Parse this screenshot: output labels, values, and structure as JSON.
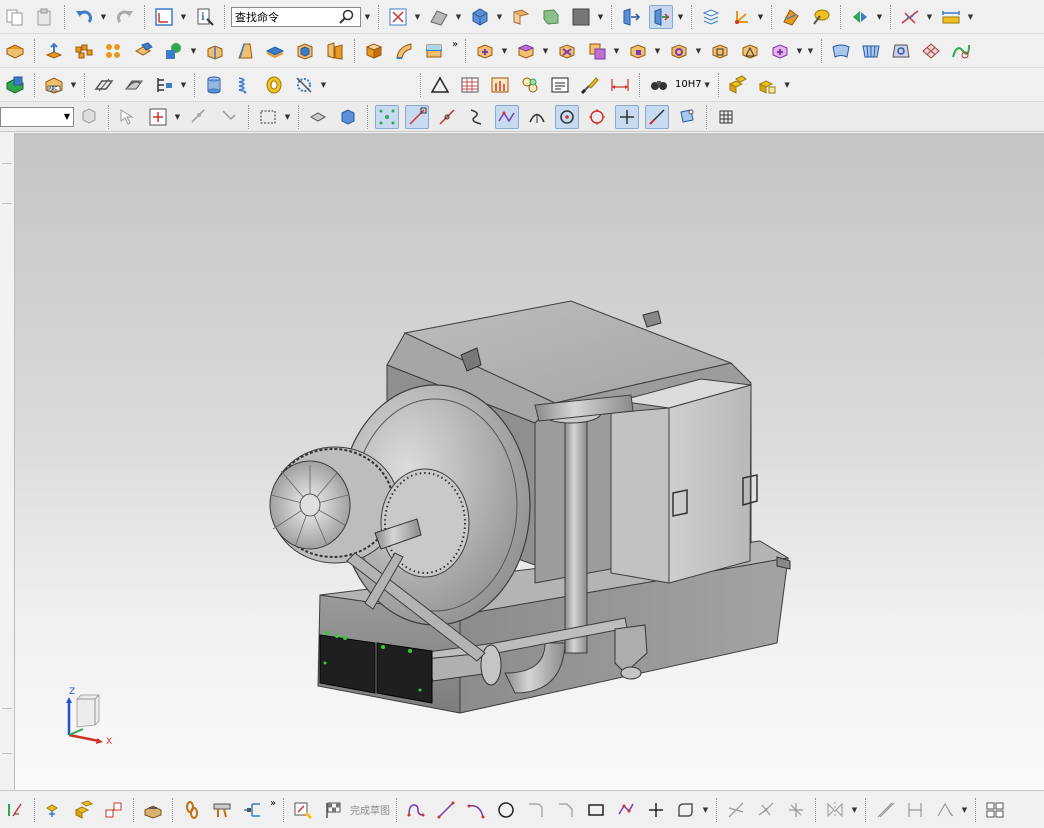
{
  "toolbar": {
    "search_placeholder": "查找命令",
    "search_value": "查找命令",
    "filter_value": "",
    "tolerance_label": "10H7"
  },
  "bottom_toolbar": {
    "finish_sketch_label": "完成草图"
  },
  "viewport": {
    "background_top": "#c4c4c4",
    "background_bottom": "#fafafa"
  },
  "triad": {
    "z_label": "Z",
    "x_label": "X"
  },
  "colors": {
    "accent_orange": "#e89a1e",
    "accent_blue": "#3c7cc8",
    "accent_yellow": "#f0c020",
    "accent_red": "#d0332a",
    "model_gray": "#a8a8a8"
  }
}
